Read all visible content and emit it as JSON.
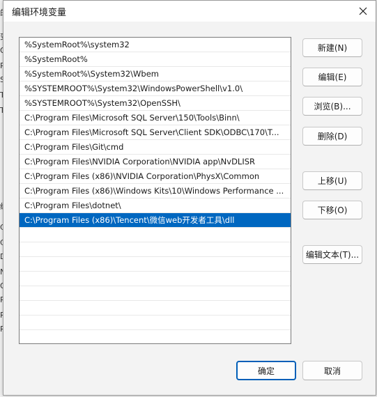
{
  "dialog": {
    "title": "编辑环境变量",
    "close_symbol": "✕"
  },
  "background_fragments": [
    "的",
    "变",
    "O",
    "Pa",
    "SK",
    "TE",
    "TN",
    "统",
    "C",
    "C",
    "Dr",
    "N",
    "O",
    "Pa",
    "PA",
    "PR"
  ],
  "list": {
    "items": [
      "%SystemRoot%\\system32",
      "%SystemRoot%",
      "%SystemRoot%\\System32\\Wbem",
      "%SYSTEMROOT%\\System32\\WindowsPowerShell\\v1.0\\",
      "%SYSTEMROOT%\\System32\\OpenSSH\\",
      "C:\\Program Files\\Microsoft SQL Server\\150\\Tools\\Binn\\",
      "C:\\Program Files\\Microsoft SQL Server\\Client SDK\\ODBC\\170\\T...",
      "C:\\Program Files\\Git\\cmd",
      "C:\\Program Files\\NVIDIA Corporation\\NVIDIA app\\NvDLISR",
      "C:\\Program Files (x86)\\NVIDIA Corporation\\PhysX\\Common",
      "C:\\Program Files (x86)\\Windows Kits\\10\\Windows Performance ...",
      "C:\\Program Files\\dotnet\\",
      "C:\\Program Files (x86)\\Tencent\\微信web开发者工具\\dll",
      "",
      "",
      "",
      "",
      "",
      "",
      "",
      ""
    ],
    "selected_index": 12
  },
  "buttons": {
    "new": "新建(N)",
    "edit": "编辑(E)",
    "browse": "浏览(B)...",
    "delete": "删除(D)",
    "move_up": "上移(U)",
    "move_down": "下移(O)",
    "edit_text": "编辑文本(T)...",
    "ok": "确定",
    "cancel": "取消"
  },
  "colors": {
    "selection": "#0067c0",
    "primary_border": "#005fb8"
  }
}
